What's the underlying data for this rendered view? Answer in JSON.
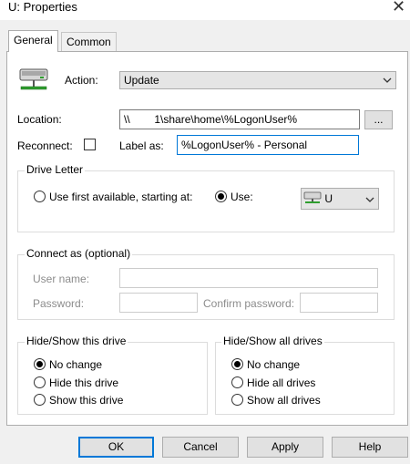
{
  "window": {
    "title": "U: Properties",
    "close_glyph": "✕"
  },
  "tabs": [
    {
      "label": "General",
      "active": true
    },
    {
      "label": "Common",
      "active": false
    }
  ],
  "action": {
    "label": "Action:",
    "value": "Update",
    "icon": "network-drive-icon"
  },
  "location": {
    "label": "Location:",
    "value": "\\\\        1\\share\\home\\%LogonUser%",
    "browse_label": "..."
  },
  "reconnect": {
    "label": "Reconnect:",
    "checked": false
  },
  "label_as": {
    "label": "Label as:",
    "value": "%LogonUser% - Personal"
  },
  "drive_letter": {
    "legend": "Drive Letter",
    "first_available_label": "Use first available, starting at:",
    "use_label": "Use:",
    "selected": "use",
    "use_value": "U"
  },
  "connect_as": {
    "legend": "Connect as (optional)",
    "user_name_label": "User name:",
    "password_label": "Password:",
    "confirm_password_label": "Confirm password:"
  },
  "hide_show_drive": {
    "legend": "Hide/Show this drive",
    "options": [
      "No change",
      "Hide this drive",
      "Show this drive"
    ],
    "selected": 0
  },
  "hide_show_all": {
    "legend": "Hide/Show all drives",
    "options": [
      "No change",
      "Hide all drives",
      "Show all drives"
    ],
    "selected": 0
  },
  "buttons": {
    "ok": "OK",
    "cancel": "Cancel",
    "apply": "Apply",
    "help": "Help"
  }
}
